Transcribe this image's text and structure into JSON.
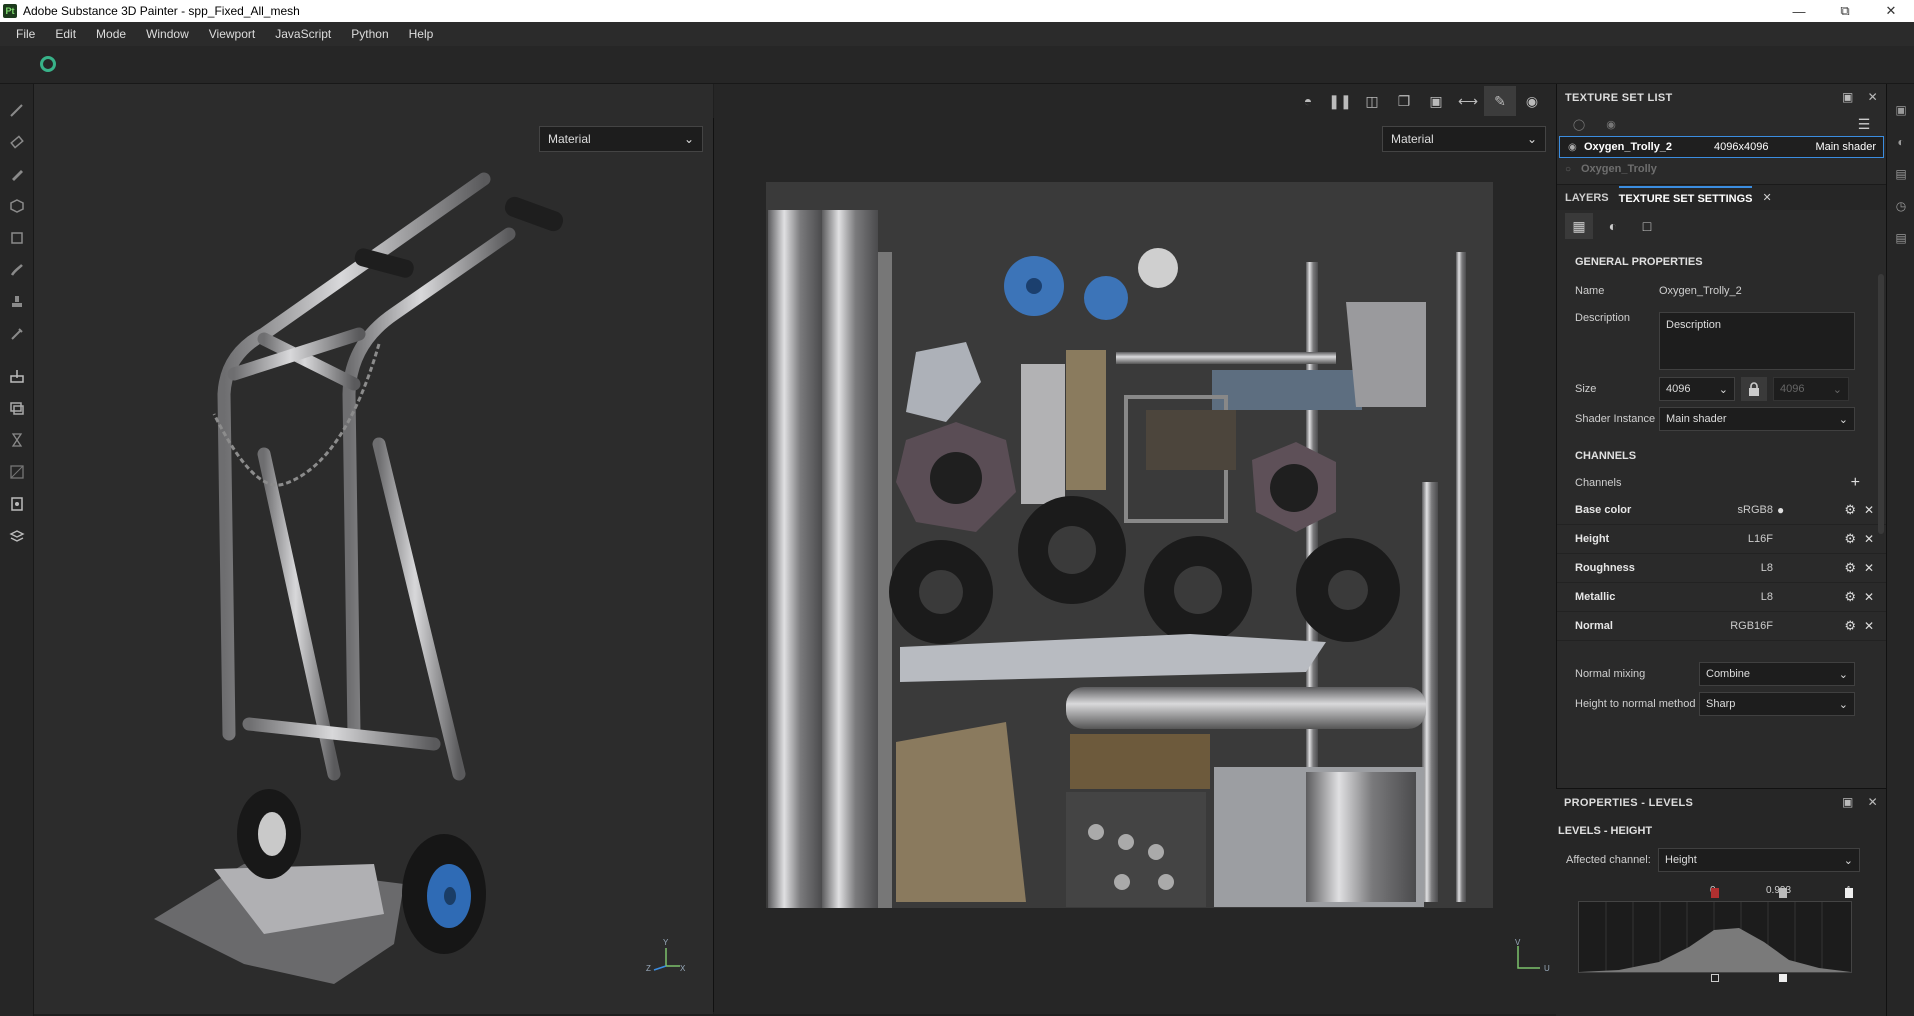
{
  "window": {
    "app_icon": "Pt",
    "title": "Adobe Substance 3D Painter - spp_Fixed_All_mesh",
    "controls": [
      "minimize",
      "restore",
      "close"
    ]
  },
  "menu": [
    "File",
    "Edit",
    "Mode",
    "Window",
    "Viewport",
    "JavaScript",
    "Python",
    "Help"
  ],
  "viewport_3d": {
    "mode_dropdown": "Material",
    "gizmo": {
      "y": "Y",
      "x": "X",
      "z": "Z"
    }
  },
  "viewport_2d": {
    "mode_dropdown": "Material",
    "gizmo": {
      "v": "V",
      "u": "U"
    }
  },
  "texture_set_list": {
    "title": "TEXTURE SET LIST",
    "rows": [
      {
        "name": "Oxygen_Trolly_2",
        "size": "4096x4096",
        "shader": "Main shader",
        "selected": true
      },
      {
        "name": "Oxygen_Trolly",
        "size": "",
        "shader": "",
        "selected": false
      }
    ]
  },
  "tabs": {
    "layers": "LAYERS",
    "texture_set_settings": "TEXTURE SET SETTINGS"
  },
  "general": {
    "heading": "GENERAL PROPERTIES",
    "name_label": "Name",
    "name_value": "Oxygen_Trolly_2",
    "description_label": "Description",
    "description_value": "Description",
    "size_label": "Size",
    "size_value": "4096",
    "size_value2": "4096",
    "shader_label": "Shader Instance",
    "shader_value": "Main shader"
  },
  "channels": {
    "heading": "CHANNELS",
    "label": "Channels",
    "items": [
      {
        "name": "Base color",
        "format": "sRGB8"
      },
      {
        "name": "Height",
        "format": "L16F"
      },
      {
        "name": "Roughness",
        "format": "L8"
      },
      {
        "name": "Metallic",
        "format": "L8"
      },
      {
        "name": "Normal",
        "format": "RGB16F"
      }
    ],
    "normal_mixing_label": "Normal mixing",
    "normal_mixing_value": "Combine",
    "h2n_label": "Height to normal method",
    "h2n_value": "Sharp"
  },
  "levels": {
    "title": "PROPERTIES - LEVELS",
    "subtitle": "LEVELS - HEIGHT",
    "affected_label": "Affected channel:",
    "affected_value": "Height",
    "input_low": "0",
    "input_mid": "0.993",
    "input_high": "1"
  },
  "colors": {
    "accent": "#3b8de0",
    "loader": "#38b289"
  }
}
